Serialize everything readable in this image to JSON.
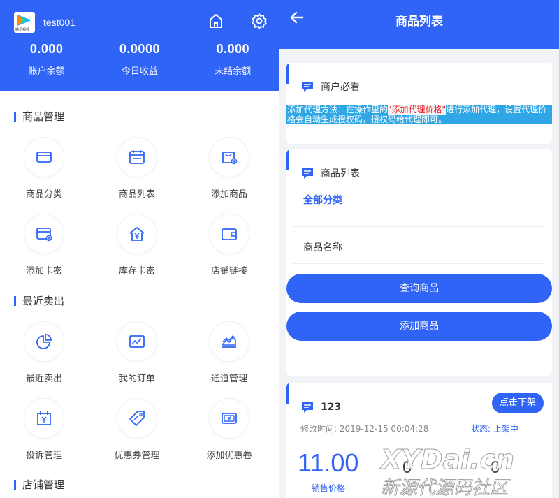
{
  "left": {
    "username": "test001",
    "logo_text": "腾讯视频",
    "stats": [
      {
        "value": "0.000",
        "label": "账户余额"
      },
      {
        "value": "0.0000",
        "label": "今日收益"
      },
      {
        "value": "0.000",
        "label": "未结余额"
      }
    ],
    "sections": [
      {
        "title": "商品管理",
        "items": [
          {
            "label": "商品分类",
            "icon": "card-icon"
          },
          {
            "label": "商品列表",
            "icon": "calendar-icon"
          },
          {
            "label": "添加商品",
            "icon": "bag-icon"
          },
          {
            "label": "添加卡密",
            "icon": "card-add-icon"
          },
          {
            "label": "库存卡密",
            "icon": "home-yen-icon"
          },
          {
            "label": "店铺链接",
            "icon": "wallet-icon"
          }
        ]
      },
      {
        "title": "最近卖出",
        "items": [
          {
            "label": "最近卖出",
            "icon": "pie-chart-icon"
          },
          {
            "label": "我的订单",
            "icon": "line-chart-icon"
          },
          {
            "label": "通道管理",
            "icon": "area-chart-icon"
          },
          {
            "label": "投诉管理",
            "icon": "yen-box-icon"
          },
          {
            "label": "优惠券管理",
            "icon": "tag-icon"
          },
          {
            "label": "添加优惠卷",
            "icon": "coupon-icon"
          }
        ]
      },
      {
        "title": "店铺管理",
        "items": []
      }
    ]
  },
  "right": {
    "title": "商品列表",
    "notice_card": {
      "heading": "商户必看",
      "notice_prefix": "添加代理方法：在操作里的",
      "notice_highlight": "\"添加代理价格\"",
      "notice_suffix": "进行添加代理，设置代理价格会自动生成授权码，授权码给代理即可。"
    },
    "list_card": {
      "heading": "商品列表",
      "category_label": "全部分类",
      "name_placeholder": "商品名称",
      "query_button": "查询商品",
      "add_button": "添加商品"
    },
    "product": {
      "name": "123",
      "action_button": "点击下架",
      "modified_label": "修改时间:",
      "modified_time": "2019-12-15 00:04:28",
      "status_label": "状态:",
      "status_value": "上架中",
      "price": "11.00",
      "price_label": "销售价格",
      "other_value_1": "0",
      "other_value_2": "0"
    }
  },
  "watermark": {
    "line1": "XYDai.cn",
    "line2": "新源代源码社区"
  },
  "colors": {
    "primary": "#2f64f6",
    "notice_bg": "#2fa6e6",
    "highlight_text": "#e8202a"
  }
}
